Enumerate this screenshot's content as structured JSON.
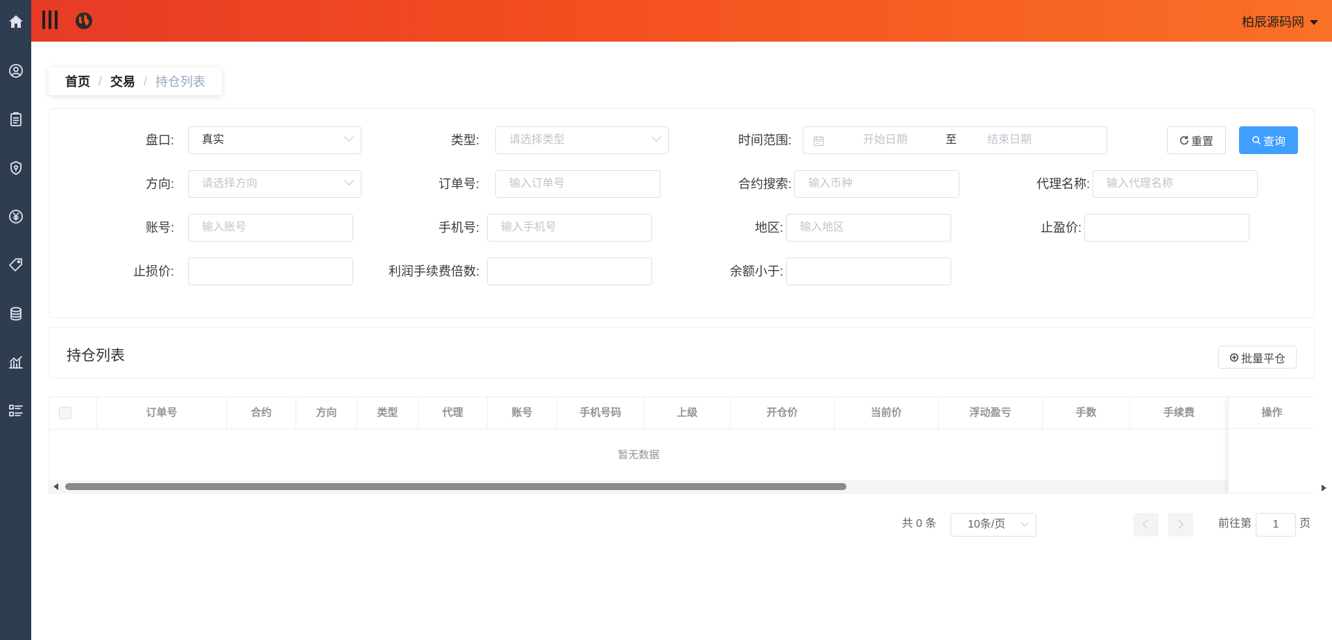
{
  "header": {
    "username": "柏辰源码网"
  },
  "breadcrumb": {
    "home": "首页",
    "section": "交易",
    "current": "持仓列表"
  },
  "filters": {
    "market_label": "盘口:",
    "market_value": "真实",
    "type_label": "类型:",
    "type_placeholder": "请选择类型",
    "time_label": "时间范围:",
    "start_placeholder": "开始日期",
    "range_sep": "至",
    "end_placeholder": "结束日期",
    "direction_label": "方向:",
    "direction_placeholder": "请选择方向",
    "order_label": "订单号:",
    "order_placeholder": "输入订单号",
    "contract_label": "合约搜索:",
    "contract_placeholder": "输入币种",
    "agent_label": "代理名称:",
    "agent_placeholder": "输入代理名称",
    "account_label": "账号:",
    "account_placeholder": "输入账号",
    "phone_label": "手机号:",
    "phone_placeholder": "输入手机号",
    "region_label": "地区:",
    "region_placeholder": "输入地区",
    "take_profit_label": "止盈价:",
    "stop_loss_label": "止损价:",
    "fee_multiple_label": "利润手续费倍数:",
    "balance_label": "余额小于:",
    "reset_button": "重置",
    "search_button": "查询"
  },
  "list": {
    "title": "持仓列表",
    "batch_close_button": "批量平仓"
  },
  "table": {
    "columns": [
      "订单号",
      "合约",
      "方向",
      "类型",
      "代理",
      "账号",
      "手机号码",
      "上级",
      "开仓价",
      "当前价",
      "浮动盈亏",
      "手数",
      "手续费"
    ],
    "fixed_column": "操作",
    "empty_text": "暂无数据"
  },
  "pagination": {
    "total_text": "共 0 条",
    "page_size": "10条/页",
    "goto_prefix": "前往第",
    "goto_value": "1",
    "goto_suffix": "页"
  },
  "colors": {
    "header_gradient_start": "#e63b26",
    "header_gradient_end": "#f97127",
    "sidebar": "#2f3d50",
    "primary": "#409eff"
  },
  "icons": [
    "home-icon",
    "user-circle-icon",
    "clipboard-icon",
    "shield-icon",
    "yen-icon",
    "tag-icon",
    "coins-icon",
    "chart-icon",
    "list-icon",
    "menu-icon",
    "globe-icon",
    "refresh-icon",
    "search-icon",
    "plus-circle-icon",
    "calendar-icon"
  ]
}
